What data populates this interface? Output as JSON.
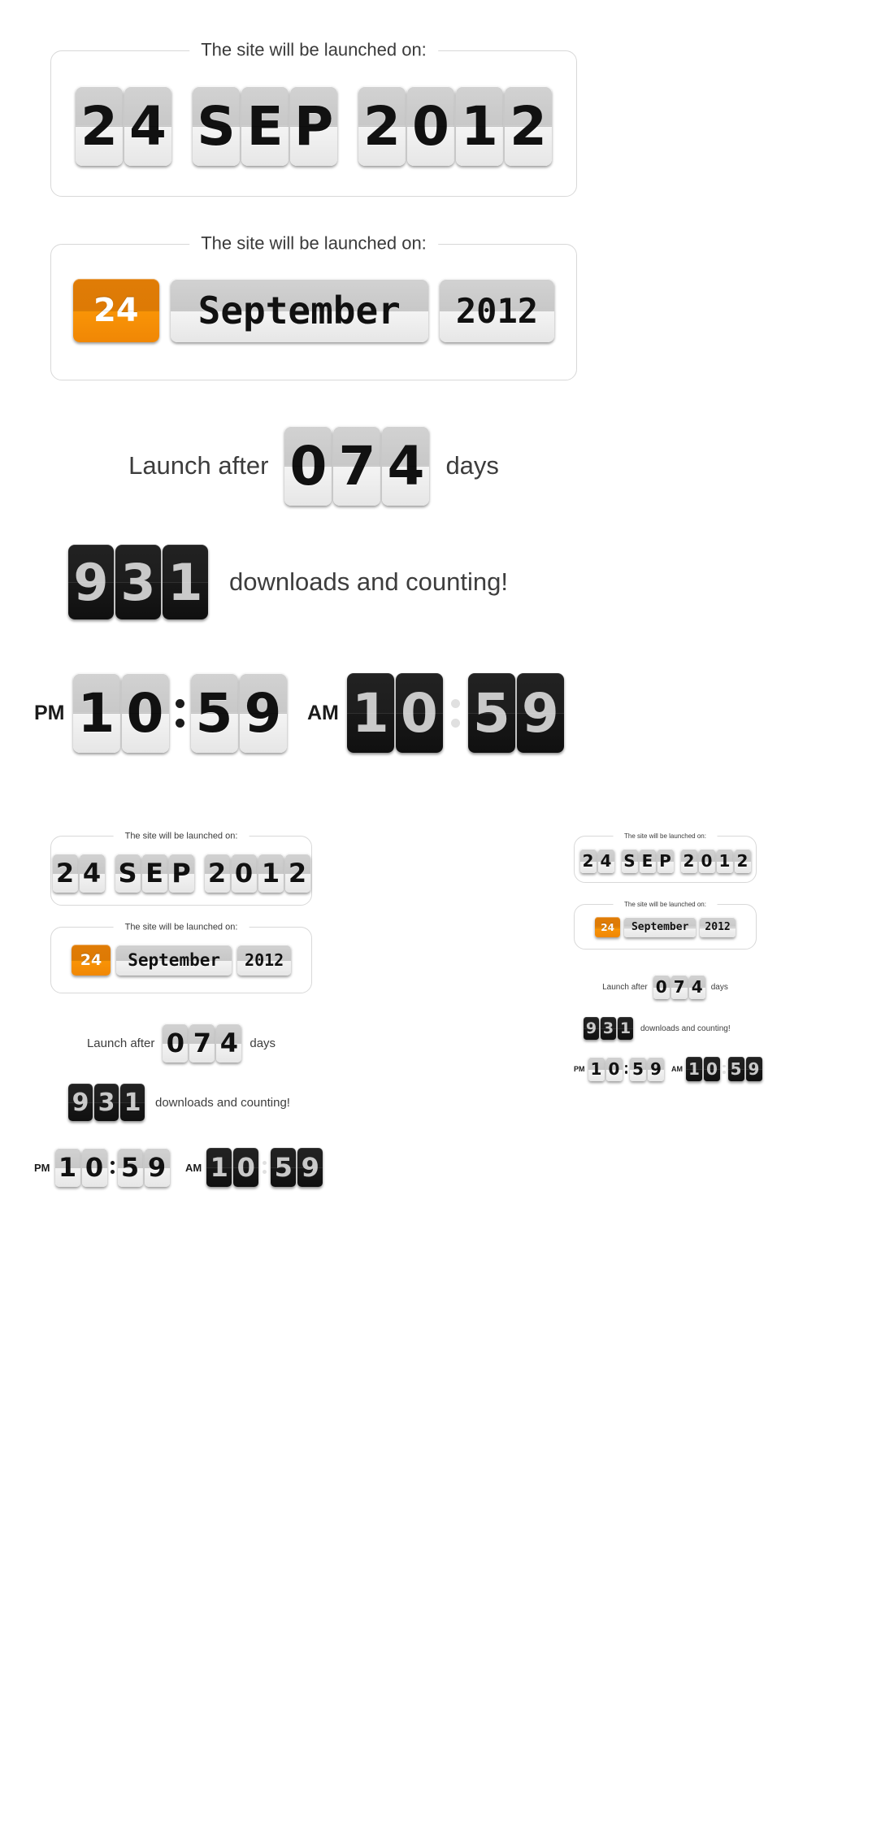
{
  "theme": {
    "accent_orange": "#F99406",
    "tile_light": "#e6e6e6",
    "tile_dark": "#181818",
    "text_dark": "#3d3d3d"
  },
  "labels": {
    "launched_on": "The site will be launched on:",
    "launch_after": "Launch after",
    "days": "days",
    "downloads": "downloads and counting!",
    "pm": "PM",
    "am": "AM"
  },
  "date_short": {
    "day": [
      "2",
      "4"
    ],
    "month": [
      "S",
      "E",
      "P"
    ],
    "year": [
      "2",
      "0",
      "1",
      "2"
    ]
  },
  "date_long": {
    "day": "24",
    "month": "September",
    "year": "2012"
  },
  "countdown": {
    "digits": [
      "0",
      "7",
      "4"
    ]
  },
  "downloads_counter": {
    "digits": [
      "9",
      "3",
      "1"
    ]
  },
  "clock_light": {
    "meridiem": "PM",
    "hours": [
      "1",
      "0"
    ],
    "minutes": [
      "5",
      "9"
    ]
  },
  "clock_dark": {
    "meridiem": "AM",
    "hours": [
      "1",
      "0"
    ],
    "minutes": [
      "5",
      "9"
    ]
  }
}
